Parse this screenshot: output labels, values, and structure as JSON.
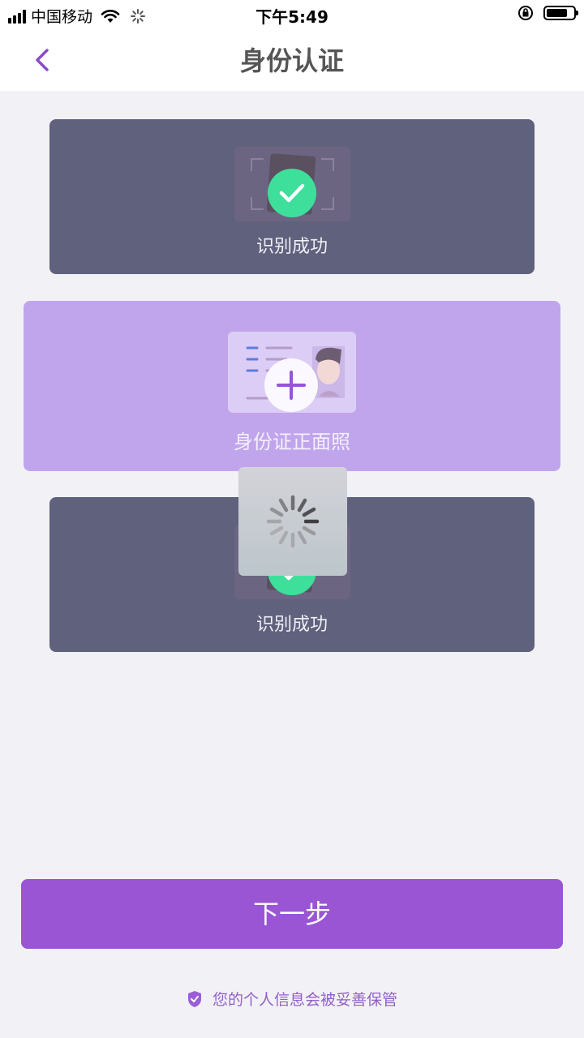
{
  "status_bar": {
    "carrier": "中国移动",
    "time": "下午5:49"
  },
  "nav": {
    "title": "身份认证",
    "back_icon": "chevron-left-icon"
  },
  "cards": [
    {
      "label": "识别成功",
      "state": "success",
      "icon": "check-circle-icon"
    },
    {
      "label": "身份证正面照",
      "state": "upload",
      "icon": "plus-icon"
    },
    {
      "label": "识别成功",
      "state": "success",
      "icon": "check-circle-icon"
    }
  ],
  "loading": {
    "icon": "spinner-icon"
  },
  "next_button": {
    "label": "下一步"
  },
  "privacy": {
    "text": "您的个人信息会被妥善保管",
    "icon": "shield-check-icon"
  },
  "colors": {
    "accent": "#9955d4",
    "card_dark": "#60617c",
    "card_active": "#c1a5ec",
    "success": "#3ddf9a"
  }
}
